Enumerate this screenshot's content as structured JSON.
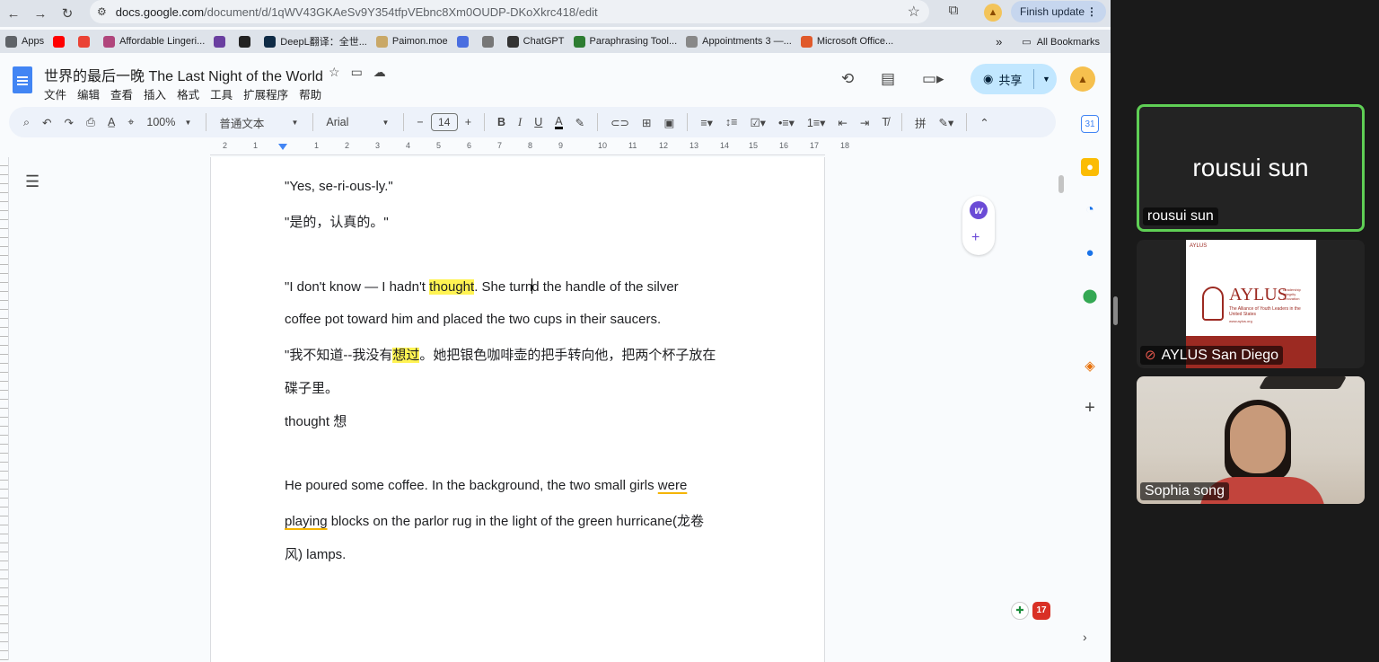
{
  "browser": {
    "url_domain": "docs.google.com",
    "url_path": "/document/d/1qWV43GKAeSv9Y354tfpVEbnc8Xm0OUDP-DKoXkrc418/edit",
    "finish_update_label": "Finish update"
  },
  "bookmarks": [
    {
      "label": "Apps",
      "color": "#5f6368"
    },
    {
      "label": "",
      "color": "#ff0000"
    },
    {
      "label": "",
      "color": "#ea4335"
    },
    {
      "label": "Affordable Lingeri...",
      "color": "#b0467c"
    },
    {
      "label": "",
      "color": "#6a3fa0"
    },
    {
      "label": "",
      "color": "#222222"
    },
    {
      "label": "DeepL翻译：全世...",
      "color": "#0f2b46"
    },
    {
      "label": "Paimon.moe",
      "color": "#c9a867"
    },
    {
      "label": "",
      "color": "#4a6ee0"
    },
    {
      "label": "",
      "color": "#777777"
    },
    {
      "label": "ChatGPT",
      "color": "#333333"
    },
    {
      "label": "Paraphrasing Tool...",
      "color": "#2e7d32"
    },
    {
      "label": "Appointments 3 —...",
      "color": "#888888"
    },
    {
      "label": "Microsoft Office...",
      "color": "#e05a2b"
    }
  ],
  "bookmarks_more": "»",
  "all_bookmarks_label": "All Bookmarks",
  "docs": {
    "title": "世界的最后一晚 The Last Night of the World",
    "menu": [
      "文件",
      "编辑",
      "查看",
      "插入",
      "格式",
      "工具",
      "扩展程序",
      "帮助"
    ],
    "share_label": "共享"
  },
  "toolbar": {
    "zoom": "100%",
    "style": "普通文本",
    "font": "Arial",
    "font_size": "14"
  },
  "ruler_ticks": [
    "2",
    "1",
    "1",
    "2",
    "3",
    "4",
    "5",
    "6",
    "7",
    "8",
    "9",
    "10",
    "11",
    "12",
    "13",
    "14",
    "15",
    "16",
    "17",
    "18"
  ],
  "document": {
    "line1": "\"Yes, se-ri-ous-ly.\"",
    "line2": "\"是的，认真的。\"",
    "line3_pre": "\"I don't know — I hadn't ",
    "line3_hl": "thought",
    "line3_mid": ". She turn",
    "line3_post": "d the handle of the silver",
    "line4": "coffee pot toward him and placed the two cups in their saucers.",
    "line5_pre": "\"我不知道--我没有",
    "line5_hl": "想过",
    "line5_post": "。她把银色咖啡壶的把手转向他，把两个杯子放在",
    "line6": "碟子里。",
    "line7": "thought 想",
    "line8_pre": "He poured some coffee. In the background, the two small girls ",
    "line8_sq": "were",
    "line9_sq": "playing",
    "line9_post": " blocks on the parlor rug in the light of the green hurricane(龙卷",
    "line10": "风) lamps."
  },
  "badges": {
    "count": "17"
  },
  "participants": [
    {
      "name": "rousui sun",
      "display": "rousui sun",
      "active": true
    },
    {
      "name": "AYLUS San Diego",
      "muted": true
    },
    {
      "name": "Sophia song"
    }
  ],
  "aylus": {
    "small_label": "AYLUS",
    "logo": "AYLUS",
    "tagline_1": "Leadership",
    "tagline_2": "Integrity",
    "tagline_3": "Innovation",
    "subtitle": "The Alliance of Youth Leaders in the United States",
    "url": "www.aylus.org"
  }
}
